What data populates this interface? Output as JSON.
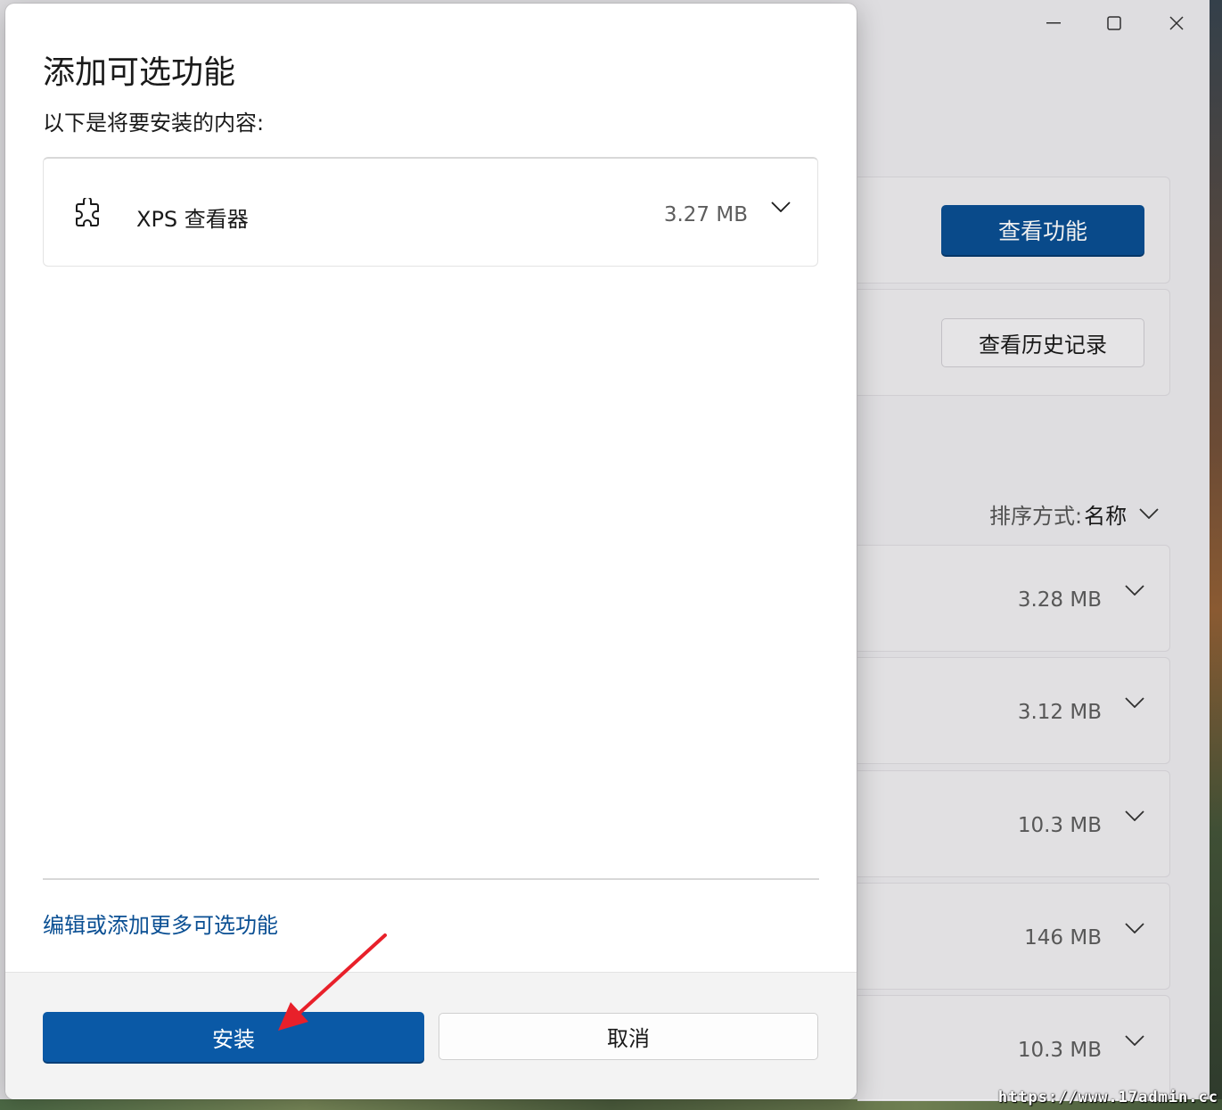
{
  "background_window": {
    "window_controls": {
      "minimize": "—",
      "maximize": "☐",
      "close": "✕"
    },
    "view_features_button": "查看功能",
    "view_history_button": "查看历史记录",
    "sort": {
      "label": "排序方式:",
      "value": "名称"
    },
    "installed_features": [
      {
        "size": "3.28 MB"
      },
      {
        "size": "3.12 MB"
      },
      {
        "size": "10.3 MB"
      },
      {
        "size": "146 MB"
      },
      {
        "size": "10.3 MB"
      }
    ]
  },
  "dialog": {
    "title": "添加可选功能",
    "subtitle": "以下是将要安装的内容:",
    "feature": {
      "icon": "puzzle-icon",
      "name": "XPS 查看器",
      "size": "3.27 MB"
    },
    "more_link": "编辑或添加更多可选功能",
    "install_button": "安装",
    "cancel_button": "取消"
  },
  "colors": {
    "accent": "#0a59a6",
    "link": "#0a4f93",
    "annotation_arrow": "#e8202a"
  },
  "watermark": "https://www.17admin.cc"
}
